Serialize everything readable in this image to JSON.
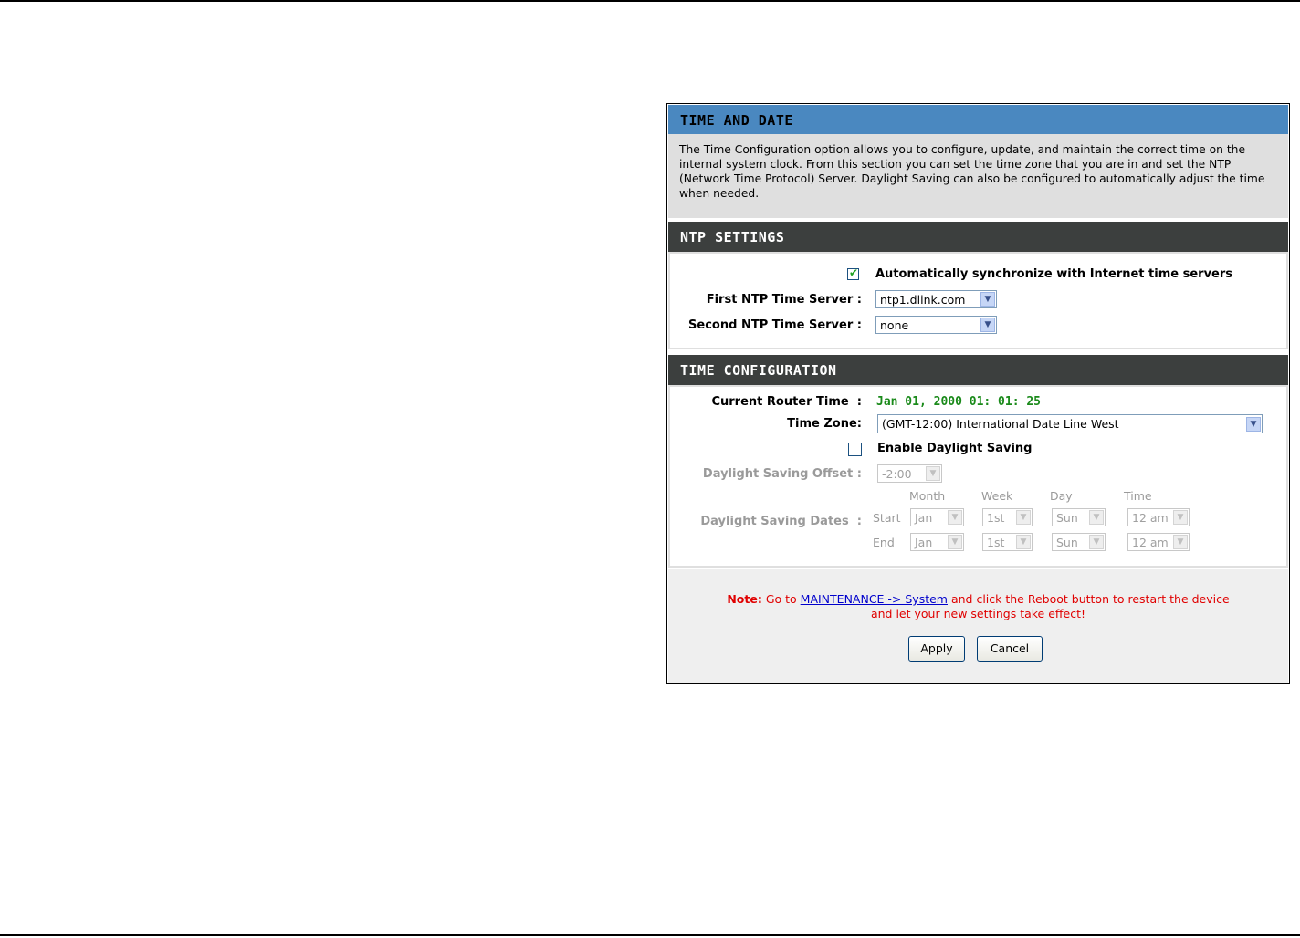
{
  "time_and_date": {
    "title": "TIME AND DATE",
    "description": "The Time Configuration option allows you to configure, update, and maintain the correct time on the internal system clock. From this section you can set the time zone that you are in and set the NTP (Network Time Protocol) Server. Daylight Saving can also be configured to automatically adjust the time when needed."
  },
  "ntp_settings": {
    "title": "NTP SETTINGS",
    "auto_sync_label": "Automatically synchronize with Internet time servers",
    "auto_sync_checked": true,
    "first_server_label": "First NTP Time Server",
    "first_server_value": "ntp1.dlink.com",
    "second_server_label": "Second NTP Time Server",
    "second_server_value": "none"
  },
  "time_configuration": {
    "title": "TIME CONFIGURATION",
    "current_time_label": "Current Router Time",
    "current_time_value": "Jan 01, 2000 01: 01: 25",
    "time_zone_label": "Time Zone",
    "time_zone_value": "(GMT-12:00) International Date Line West",
    "daylight_label": "Enable Daylight Saving",
    "daylight_checked": false,
    "offset_label": "Daylight Saving Offset",
    "offset_value": "-2:00",
    "dates_label": "Daylight Saving Dates",
    "col_month": "Month",
    "col_week": "Week",
    "col_day": "Day",
    "col_time": "Time",
    "start_label": "Start",
    "end_label": "End",
    "start": {
      "month": "Jan",
      "week": "1st",
      "day": "Sun",
      "time": "12 am"
    },
    "end": {
      "month": "Jan",
      "week": "1st",
      "day": "Sun",
      "time": "12 am"
    }
  },
  "footer": {
    "note_prefix": "Note:",
    "note_go_to": "Go to",
    "note_link": "MAINTENANCE -> System",
    "note_after_link": "and click the Reboot button to restart the device",
    "note_line2": "and let your new settings take effect!",
    "apply_label": "Apply",
    "cancel_label": "Cancel"
  },
  "colors": {
    "header_blue": "#4a88c0",
    "header_dark": "#3c3f3e",
    "router_time_green": "#1a8a1a",
    "note_red": "#e00000"
  }
}
